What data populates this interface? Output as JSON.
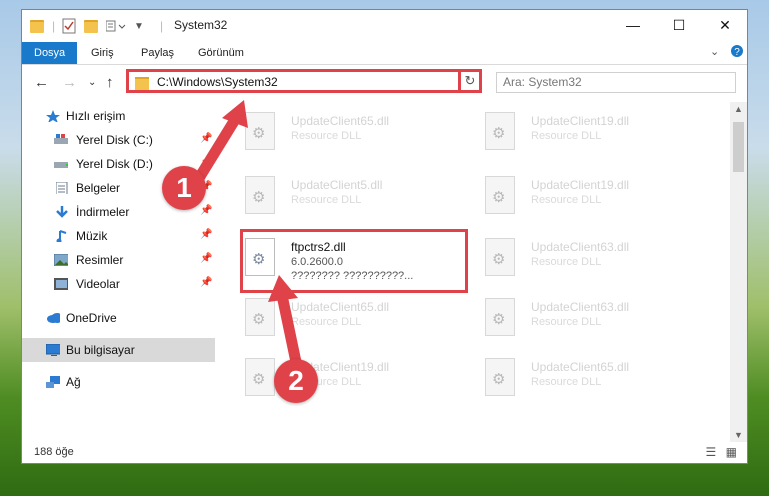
{
  "window": {
    "title": "System32",
    "controls": {
      "minimize": "—",
      "maximize": "☐",
      "close": "✕"
    }
  },
  "ribbon": {
    "tabs": [
      {
        "label": "Dosya",
        "active": true
      },
      {
        "label": "Giriş",
        "active": false
      },
      {
        "label": "Paylaş",
        "active": false
      },
      {
        "label": "Görünüm",
        "active": false
      }
    ],
    "expand_icon": "chevron-down-icon",
    "help_icon": "help-icon"
  },
  "address": {
    "path": "C:\\Windows\\System32",
    "search_placeholder": "Ara: System32"
  },
  "sidebar": {
    "items": [
      {
        "label": "Hızlı erişim",
        "icon": "star-icon"
      },
      {
        "label": "Yerel Disk (C:)",
        "icon": "drive-icon"
      },
      {
        "label": "Yerel Disk (D:)",
        "icon": "drive-icon"
      },
      {
        "label": "Belgeler",
        "icon": "document-icon"
      },
      {
        "label": "İndirmeler",
        "icon": "download-icon"
      },
      {
        "label": "Müzik",
        "icon": "music-icon"
      },
      {
        "label": "Resimler",
        "icon": "pictures-icon"
      },
      {
        "label": "Videolar",
        "icon": "video-icon"
      },
      {
        "label": "OneDrive",
        "icon": "cloud-icon"
      },
      {
        "label": "Bu bilgisayar",
        "icon": "computer-icon"
      },
      {
        "label": "Ağ",
        "icon": "network-icon"
      }
    ]
  },
  "files": [
    {
      "name": "UpdateClient65.dll",
      "desc": "Resource DLL"
    },
    {
      "name": "UpdateClient19.dll",
      "desc": "Resource DLL"
    },
    {
      "name": "UpdateClient5.dll",
      "desc": "Resource DLL"
    },
    {
      "name": "UpdateClient19.dll",
      "desc": "Resource DLL"
    },
    {
      "name": "ftpctrs2.dll",
      "desc": "6.0.2600.0",
      "desc2": "???????? ??????????..."
    },
    {
      "name": "UpdateClient63.dll",
      "desc": "Resource DLL"
    },
    {
      "name": "UpdateClient65.dll",
      "desc": "Resource DLL"
    },
    {
      "name": "UpdateClient63.dll",
      "desc": "Resource DLL"
    },
    {
      "name": "UpdateClient19.dll",
      "desc": "Resource DLL"
    },
    {
      "name": "UpdateClient65.dll",
      "desc": "Resource DLL"
    }
  ],
  "status": {
    "count": "188 öğe"
  },
  "callouts": [
    {
      "label": "1"
    },
    {
      "label": "2"
    }
  ],
  "colors": {
    "accent": "#1979ca",
    "callout": "#e0424a"
  }
}
